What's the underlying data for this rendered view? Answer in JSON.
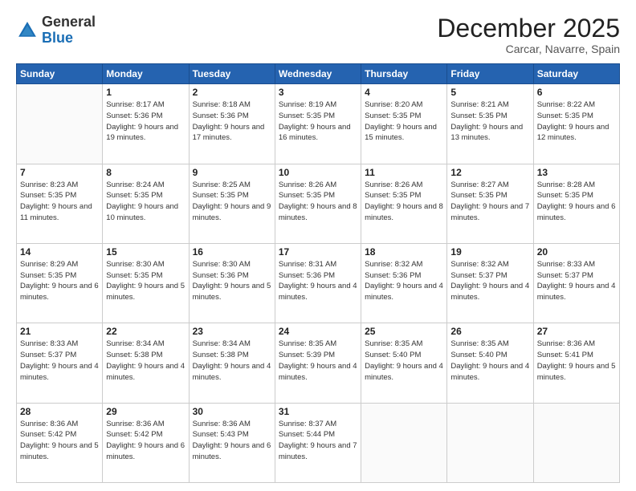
{
  "header": {
    "logo_general": "General",
    "logo_blue": "Blue",
    "month_title": "December 2025",
    "location": "Carcar, Navarre, Spain"
  },
  "days_of_week": [
    "Sunday",
    "Monday",
    "Tuesday",
    "Wednesday",
    "Thursday",
    "Friday",
    "Saturday"
  ],
  "weeks": [
    [
      {
        "day": "",
        "sunrise": "",
        "sunset": "",
        "daylight": ""
      },
      {
        "day": "1",
        "sunrise": "Sunrise: 8:17 AM",
        "sunset": "Sunset: 5:36 PM",
        "daylight": "Daylight: 9 hours and 19 minutes."
      },
      {
        "day": "2",
        "sunrise": "Sunrise: 8:18 AM",
        "sunset": "Sunset: 5:36 PM",
        "daylight": "Daylight: 9 hours and 17 minutes."
      },
      {
        "day": "3",
        "sunrise": "Sunrise: 8:19 AM",
        "sunset": "Sunset: 5:35 PM",
        "daylight": "Daylight: 9 hours and 16 minutes."
      },
      {
        "day": "4",
        "sunrise": "Sunrise: 8:20 AM",
        "sunset": "Sunset: 5:35 PM",
        "daylight": "Daylight: 9 hours and 15 minutes."
      },
      {
        "day": "5",
        "sunrise": "Sunrise: 8:21 AM",
        "sunset": "Sunset: 5:35 PM",
        "daylight": "Daylight: 9 hours and 13 minutes."
      },
      {
        "day": "6",
        "sunrise": "Sunrise: 8:22 AM",
        "sunset": "Sunset: 5:35 PM",
        "daylight": "Daylight: 9 hours and 12 minutes."
      }
    ],
    [
      {
        "day": "7",
        "sunrise": "Sunrise: 8:23 AM",
        "sunset": "Sunset: 5:35 PM",
        "daylight": "Daylight: 9 hours and 11 minutes."
      },
      {
        "day": "8",
        "sunrise": "Sunrise: 8:24 AM",
        "sunset": "Sunset: 5:35 PM",
        "daylight": "Daylight: 9 hours and 10 minutes."
      },
      {
        "day": "9",
        "sunrise": "Sunrise: 8:25 AM",
        "sunset": "Sunset: 5:35 PM",
        "daylight": "Daylight: 9 hours and 9 minutes."
      },
      {
        "day": "10",
        "sunrise": "Sunrise: 8:26 AM",
        "sunset": "Sunset: 5:35 PM",
        "daylight": "Daylight: 9 hours and 8 minutes."
      },
      {
        "day": "11",
        "sunrise": "Sunrise: 8:26 AM",
        "sunset": "Sunset: 5:35 PM",
        "daylight": "Daylight: 9 hours and 8 minutes."
      },
      {
        "day": "12",
        "sunrise": "Sunrise: 8:27 AM",
        "sunset": "Sunset: 5:35 PM",
        "daylight": "Daylight: 9 hours and 7 minutes."
      },
      {
        "day": "13",
        "sunrise": "Sunrise: 8:28 AM",
        "sunset": "Sunset: 5:35 PM",
        "daylight": "Daylight: 9 hours and 6 minutes."
      }
    ],
    [
      {
        "day": "14",
        "sunrise": "Sunrise: 8:29 AM",
        "sunset": "Sunset: 5:35 PM",
        "daylight": "Daylight: 9 hours and 6 minutes."
      },
      {
        "day": "15",
        "sunrise": "Sunrise: 8:30 AM",
        "sunset": "Sunset: 5:35 PM",
        "daylight": "Daylight: 9 hours and 5 minutes."
      },
      {
        "day": "16",
        "sunrise": "Sunrise: 8:30 AM",
        "sunset": "Sunset: 5:36 PM",
        "daylight": "Daylight: 9 hours and 5 minutes."
      },
      {
        "day": "17",
        "sunrise": "Sunrise: 8:31 AM",
        "sunset": "Sunset: 5:36 PM",
        "daylight": "Daylight: 9 hours and 4 minutes."
      },
      {
        "day": "18",
        "sunrise": "Sunrise: 8:32 AM",
        "sunset": "Sunset: 5:36 PM",
        "daylight": "Daylight: 9 hours and 4 minutes."
      },
      {
        "day": "19",
        "sunrise": "Sunrise: 8:32 AM",
        "sunset": "Sunset: 5:37 PM",
        "daylight": "Daylight: 9 hours and 4 minutes."
      },
      {
        "day": "20",
        "sunrise": "Sunrise: 8:33 AM",
        "sunset": "Sunset: 5:37 PM",
        "daylight": "Daylight: 9 hours and 4 minutes."
      }
    ],
    [
      {
        "day": "21",
        "sunrise": "Sunrise: 8:33 AM",
        "sunset": "Sunset: 5:37 PM",
        "daylight": "Daylight: 9 hours and 4 minutes."
      },
      {
        "day": "22",
        "sunrise": "Sunrise: 8:34 AM",
        "sunset": "Sunset: 5:38 PM",
        "daylight": "Daylight: 9 hours and 4 minutes."
      },
      {
        "day": "23",
        "sunrise": "Sunrise: 8:34 AM",
        "sunset": "Sunset: 5:38 PM",
        "daylight": "Daylight: 9 hours and 4 minutes."
      },
      {
        "day": "24",
        "sunrise": "Sunrise: 8:35 AM",
        "sunset": "Sunset: 5:39 PM",
        "daylight": "Daylight: 9 hours and 4 minutes."
      },
      {
        "day": "25",
        "sunrise": "Sunrise: 8:35 AM",
        "sunset": "Sunset: 5:40 PM",
        "daylight": "Daylight: 9 hours and 4 minutes."
      },
      {
        "day": "26",
        "sunrise": "Sunrise: 8:35 AM",
        "sunset": "Sunset: 5:40 PM",
        "daylight": "Daylight: 9 hours and 4 minutes."
      },
      {
        "day": "27",
        "sunrise": "Sunrise: 8:36 AM",
        "sunset": "Sunset: 5:41 PM",
        "daylight": "Daylight: 9 hours and 5 minutes."
      }
    ],
    [
      {
        "day": "28",
        "sunrise": "Sunrise: 8:36 AM",
        "sunset": "Sunset: 5:42 PM",
        "daylight": "Daylight: 9 hours and 5 minutes."
      },
      {
        "day": "29",
        "sunrise": "Sunrise: 8:36 AM",
        "sunset": "Sunset: 5:42 PM",
        "daylight": "Daylight: 9 hours and 6 minutes."
      },
      {
        "day": "30",
        "sunrise": "Sunrise: 8:36 AM",
        "sunset": "Sunset: 5:43 PM",
        "daylight": "Daylight: 9 hours and 6 minutes."
      },
      {
        "day": "31",
        "sunrise": "Sunrise: 8:37 AM",
        "sunset": "Sunset: 5:44 PM",
        "daylight": "Daylight: 9 hours and 7 minutes."
      },
      {
        "day": "",
        "sunrise": "",
        "sunset": "",
        "daylight": ""
      },
      {
        "day": "",
        "sunrise": "",
        "sunset": "",
        "daylight": ""
      },
      {
        "day": "",
        "sunrise": "",
        "sunset": "",
        "daylight": ""
      }
    ]
  ]
}
